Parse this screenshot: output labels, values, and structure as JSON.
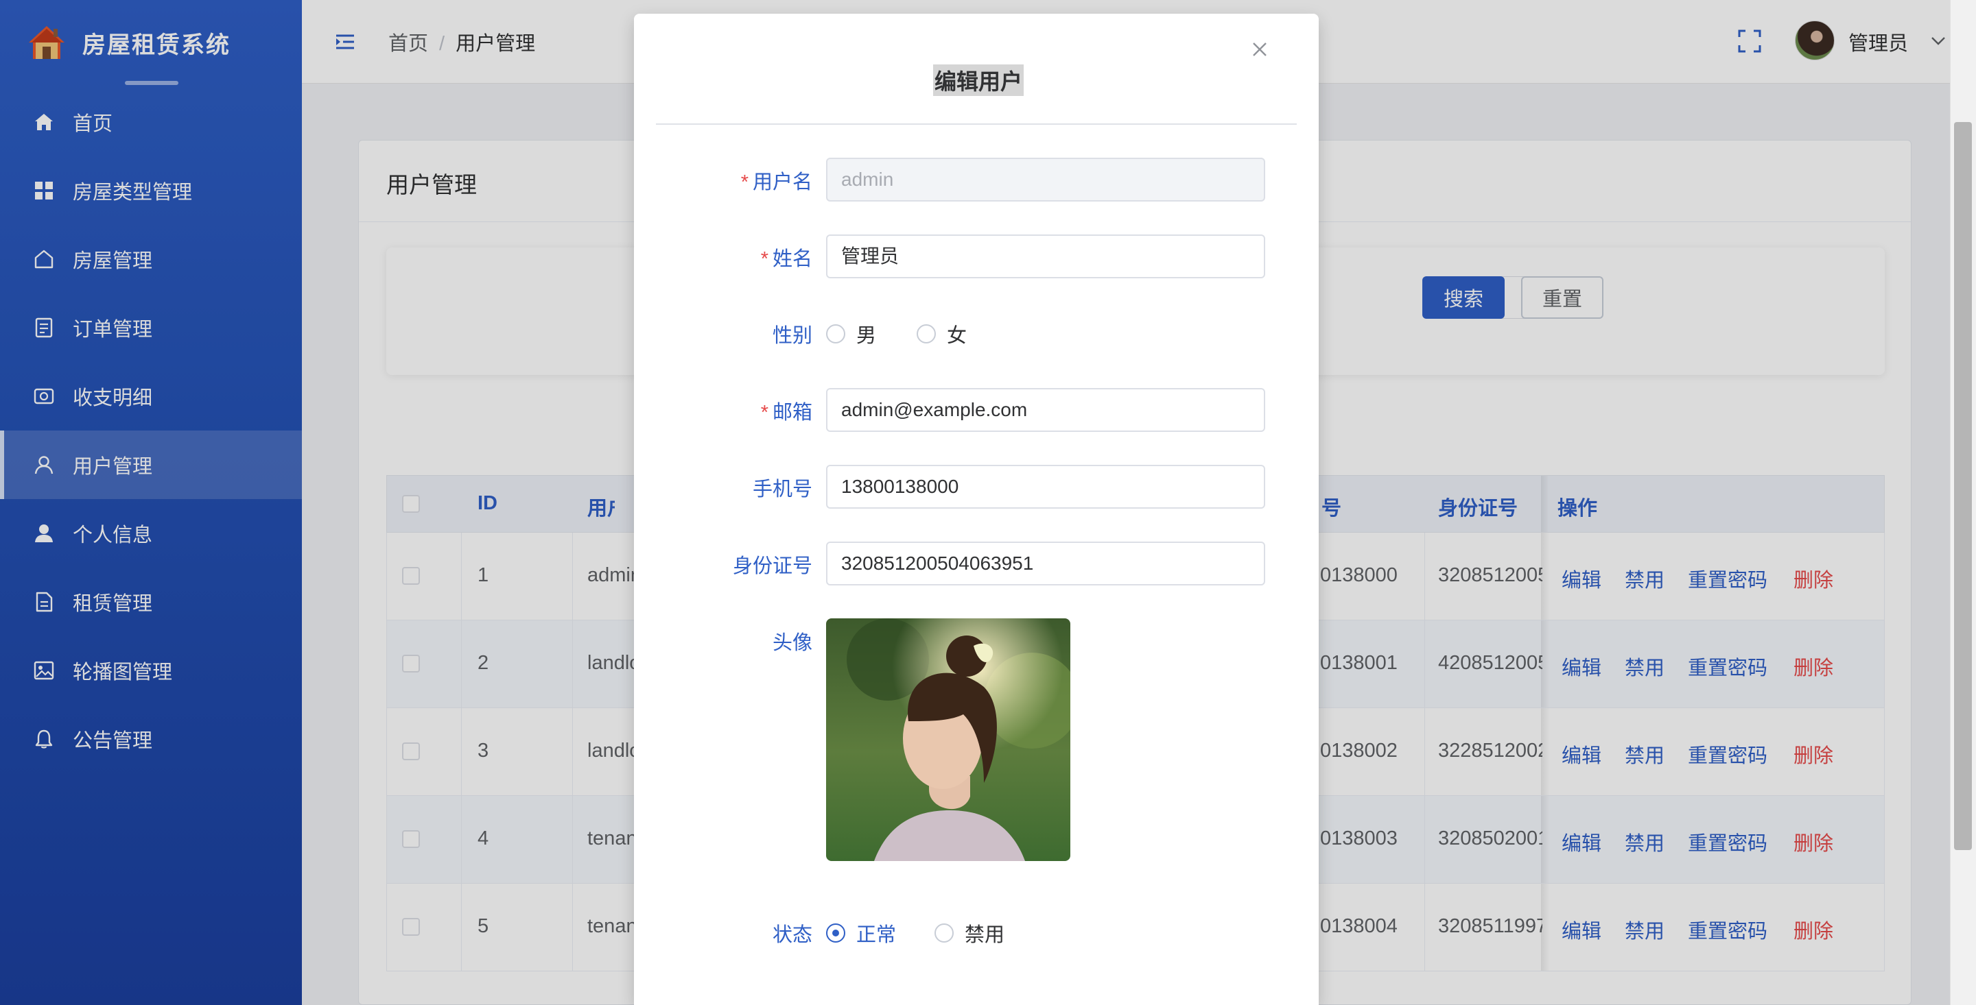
{
  "brand": {
    "title": "房屋租赁系统"
  },
  "sidebar": {
    "items": [
      {
        "label": "首页",
        "icon": "home-icon"
      },
      {
        "label": "房屋类型管理",
        "icon": "grid-icon"
      },
      {
        "label": "房屋管理",
        "icon": "house-outline-icon"
      },
      {
        "label": "订单管理",
        "icon": "document-icon"
      },
      {
        "label": "收支明细",
        "icon": "wallet-icon"
      },
      {
        "label": "用户管理",
        "icon": "user-outline-icon",
        "active": true
      },
      {
        "label": "个人信息",
        "icon": "user-filled-icon"
      },
      {
        "label": "租赁管理",
        "icon": "file-icon"
      },
      {
        "label": "轮播图管理",
        "icon": "picture-icon"
      },
      {
        "label": "公告管理",
        "icon": "bell-icon"
      }
    ]
  },
  "header": {
    "breadcrumb": {
      "home": "首页",
      "separator": "/",
      "current": "用户管理"
    },
    "user_name": "管理员"
  },
  "page": {
    "title": "用户管理"
  },
  "search": {
    "search_label": "搜索",
    "reset_label": "重置"
  },
  "table": {
    "headers": {
      "id": "ID",
      "username": "用户名",
      "phone": "号",
      "id_card": "身份证号",
      "actions": "操作"
    },
    "actions": {
      "edit": "编辑",
      "disable": "禁用",
      "reset_password": "重置密码",
      "delete": "删除"
    },
    "rows": [
      {
        "id": "1",
        "username": "admin",
        "phone": "0138000",
        "id_card": "3208512005"
      },
      {
        "id": "2",
        "username": "landlo",
        "phone": "0138001",
        "id_card": "4208512005"
      },
      {
        "id": "3",
        "username": "landlo",
        "phone": "0138002",
        "id_card": "3228512002"
      },
      {
        "id": "4",
        "username": "tenan",
        "phone": "0138003",
        "id_card": "3208502001"
      },
      {
        "id": "5",
        "username": "tenan",
        "phone": "0138004",
        "id_card": "3208511997"
      }
    ]
  },
  "dialog": {
    "title": "编辑用户",
    "fields": {
      "username": {
        "label": "用户名",
        "value": "admin",
        "required": true,
        "disabled": true
      },
      "name": {
        "label": "姓名",
        "value": "管理员",
        "required": true
      },
      "gender": {
        "label": "性别",
        "options": [
          "男",
          "女"
        ],
        "selected": ""
      },
      "email": {
        "label": "邮箱",
        "value": "admin@example.com",
        "required": true
      },
      "phone": {
        "label": "手机号",
        "value": "13800138000"
      },
      "id_card": {
        "label": "身份证号",
        "value": "320851200504063951"
      },
      "avatar": {
        "label": "头像"
      },
      "status": {
        "label": "状态",
        "options": [
          "正常",
          "禁用"
        ],
        "selected": "正常"
      }
    },
    "required_mark": "*"
  },
  "colors": {
    "primary": "#2f5fc6",
    "danger": "#e64a4a",
    "sidebar_bg": "#2451b4"
  }
}
